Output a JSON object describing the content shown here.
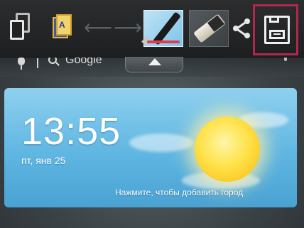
{
  "search": {
    "label": "Google"
  },
  "weather": {
    "time": "13:55",
    "date": "пт, янв 25",
    "add_city_prompt": "Нажмите, чтобы добавить город"
  },
  "toolbar": {
    "note_label": "A"
  },
  "colors": {
    "pen_ink": "#e33b4c",
    "save_highlight": "#b2284c",
    "widget_sky": "#5fb6e2",
    "sun": "#ffe24a"
  }
}
